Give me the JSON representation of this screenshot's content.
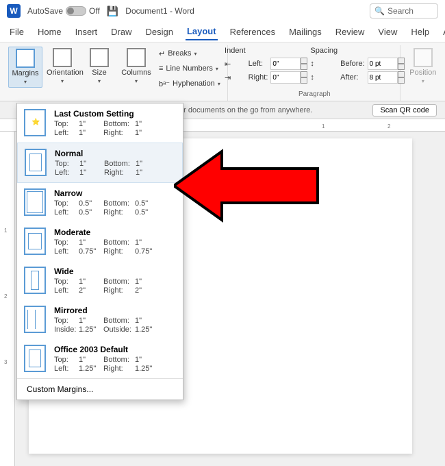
{
  "titlebar": {
    "autosave_label": "AutoSave",
    "autosave_state": "Off",
    "doc_title": "Document1 - Word",
    "search_placeholder": "Search"
  },
  "tabs": {
    "items": [
      "File",
      "Home",
      "Insert",
      "Draw",
      "Design",
      "Layout",
      "References",
      "Mailings",
      "Review",
      "View",
      "Help",
      "Acro"
    ],
    "active": "Layout"
  },
  "ribbon": {
    "page_setup": {
      "margins": "Margins",
      "orientation": "Orientation",
      "size": "Size",
      "columns": "Columns",
      "breaks": "Breaks",
      "line_numbers": "Line Numbers",
      "hyphenation": "Hyphenation"
    },
    "paragraph": {
      "indent_label": "Indent",
      "spacing_label": "Spacing",
      "left_label": "Left:",
      "right_label": "Right:",
      "before_label": "Before:",
      "after_label": "After:",
      "left_val": "0\"",
      "right_val": "0\"",
      "before_val": "0 pt",
      "after_val": "8 pt",
      "group_label": "Paragraph"
    },
    "arrange": {
      "position": "Position"
    }
  },
  "infobar": {
    "msg": "ur documents on the go from anywhere.",
    "qr_btn": "Scan QR code"
  },
  "margins_menu": {
    "items": [
      {
        "name": "Last Custom Setting",
        "thumb": "tstar",
        "top": "1\"",
        "bottom": "1\"",
        "left": "1\"",
        "right": "1\"",
        "left_lbl": "Left:",
        "right_lbl": "Right:"
      },
      {
        "name": "Normal",
        "thumb": "tnormal",
        "top": "1\"",
        "bottom": "1\"",
        "left": "1\"",
        "right": "1\"",
        "left_lbl": "Left:",
        "right_lbl": "Right:",
        "selected": true
      },
      {
        "name": "Narrow",
        "thumb": "tnarrow",
        "top": "0.5\"",
        "bottom": "0.5\"",
        "left": "0.5\"",
        "right": "0.5\"",
        "left_lbl": "Left:",
        "right_lbl": "Right:"
      },
      {
        "name": "Moderate",
        "thumb": "tmoderate",
        "top": "1\"",
        "bottom": "1\"",
        "left": "0.75\"",
        "right": "0.75\"",
        "left_lbl": "Left:",
        "right_lbl": "Right:"
      },
      {
        "name": "Wide",
        "thumb": "twide",
        "top": "1\"",
        "bottom": "1\"",
        "left": "2\"",
        "right": "2\"",
        "left_lbl": "Left:",
        "right_lbl": "Right:"
      },
      {
        "name": "Mirrored",
        "thumb": "tmirrored",
        "top": "1\"",
        "bottom": "1\"",
        "left": "1.25\"",
        "right": "1.25\"",
        "left_lbl": "Inside:",
        "right_lbl": "Outside:"
      },
      {
        "name": "Office 2003 Default",
        "thumb": "tnormal",
        "top": "1\"",
        "bottom": "1\"",
        "left": "1.25\"",
        "right": "1.25\"",
        "left_lbl": "Left:",
        "right_lbl": "Right:"
      }
    ],
    "labels": {
      "top": "Top:",
      "bottom": "Bottom:"
    },
    "custom": "Custom Margins..."
  },
  "ruler_h": [
    "1",
    "2"
  ],
  "ruler_v": [
    "1",
    "2",
    "3"
  ]
}
